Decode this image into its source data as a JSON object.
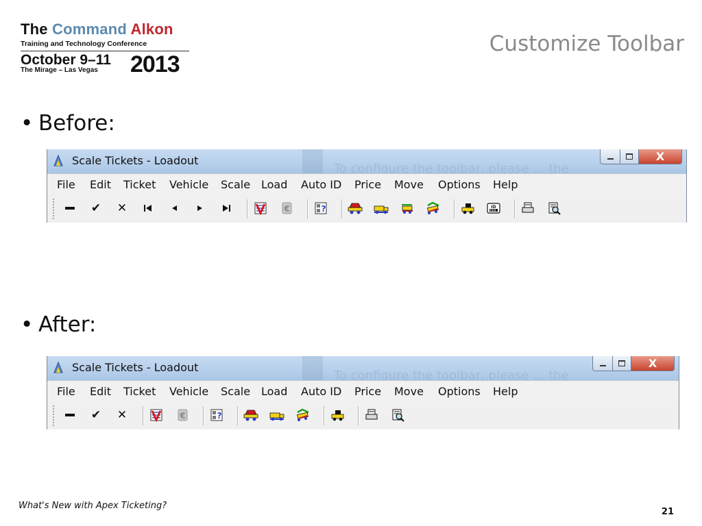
{
  "logo": {
    "line1_a": "The",
    "line1_b": "Command",
    "line1_c": "Alkon",
    "line2": "Training and Technology Conference",
    "line3": "October 9–11",
    "line4": "The Mirage – Las Vegas",
    "year": "2013"
  },
  "slide_title": "Customize Toolbar",
  "bullets": [
    {
      "text": "Before:"
    },
    {
      "text": "After:"
    }
  ],
  "window": {
    "title": "Scale Tickets - Loadout",
    "background_text": "To configure the toolbar, please ... the",
    "close_glyph": "X",
    "menu": [
      "File",
      "Edit",
      "Ticket",
      "Vehicle",
      "Scale",
      "Load",
      "Auto ID",
      "Price",
      "Move",
      "Options",
      "Help"
    ]
  },
  "toolbar_before": [
    "new-icon",
    "save-check-icon",
    "delete-x-icon",
    "first-record-icon",
    "previous-record-icon",
    "next-record-icon",
    "last-record-icon",
    "|",
    "void-ticket-icon",
    "reprint-coin-icon",
    "|",
    "query-icon",
    "|",
    "truck-red-icon",
    "truck-yellow-icon",
    "truck-exchange-icon",
    "truck-green-icon",
    "|",
    "loader-icon",
    "id-card-icon",
    "|",
    "print-icon",
    "print-preview-icon"
  ],
  "toolbar_after": [
    "new-icon",
    "save-check-icon",
    "delete-x-icon",
    "|",
    "void-ticket-icon",
    "reprint-coin-icon",
    "|",
    "query-icon",
    "|",
    "truck-red-icon",
    "truck-yellow-icon",
    "truck-green-icon",
    "|",
    "loader-icon",
    "|",
    "print-icon",
    "print-preview-icon"
  ],
  "footer": {
    "left": "What's New with Apex Ticketing?",
    "page_number": "21"
  },
  "colors": {
    "title_gray": "#8a8a8a",
    "logo_blue": "#5b8ab0",
    "logo_red": "#c0262c",
    "titlebar": "#b9d1ec"
  }
}
